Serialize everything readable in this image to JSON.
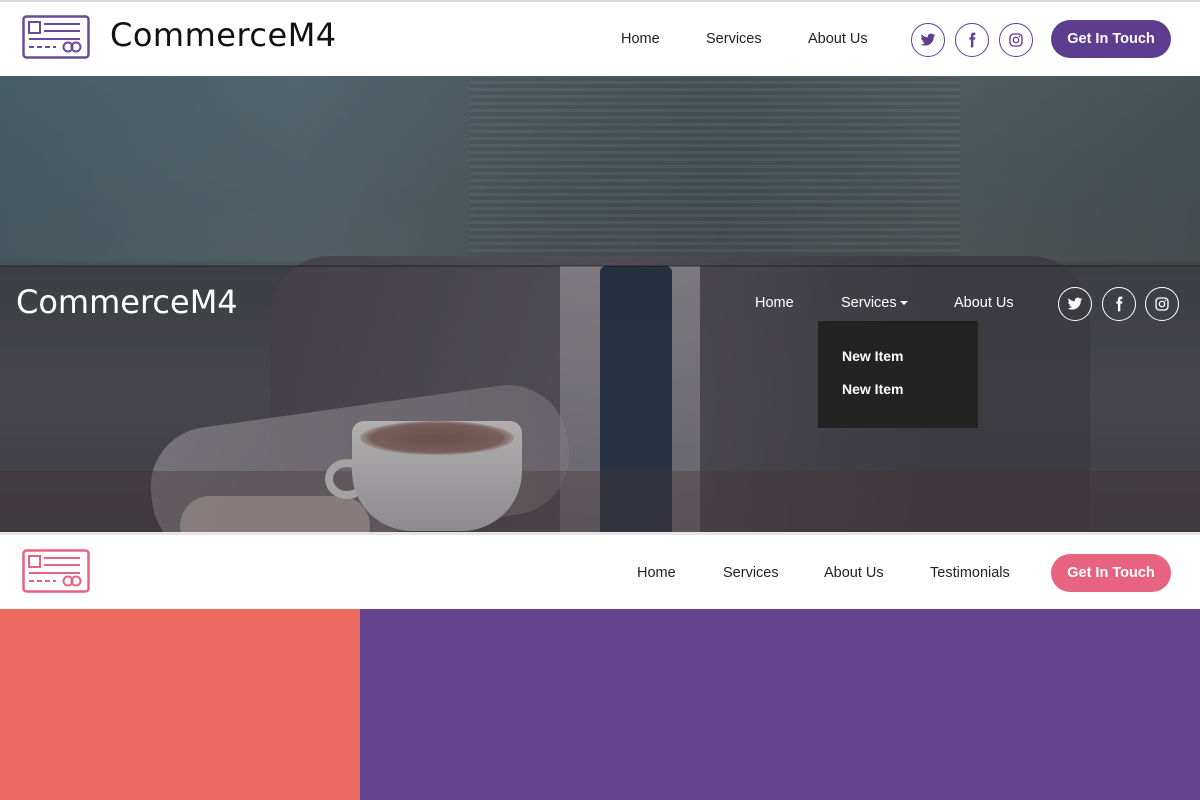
{
  "header_top": {
    "brand": "CommerceM4",
    "nav": [
      "Home",
      "Services",
      "About Us"
    ],
    "social_icons": [
      "twitter-icon",
      "facebook-icon",
      "instagram-icon"
    ],
    "cta_label": "Get In Touch",
    "accent_color": "#5c3d8f"
  },
  "hero": {
    "brand": "CommerceM4",
    "nav": [
      "Home",
      "Services",
      "About Us"
    ],
    "social_icons": [
      "twitter-icon",
      "facebook-icon",
      "instagram-icon"
    ],
    "dropdown": {
      "parent": "Services",
      "items": [
        "New Item",
        "New Item"
      ]
    }
  },
  "header_bottom": {
    "nav": [
      "Home",
      "Services",
      "About Us",
      "Testimonials"
    ],
    "cta_label": "Get In Touch",
    "accent_color": "#e8637f"
  },
  "blocks": {
    "left_color": "#eb6a5f",
    "right_color": "#66438f"
  }
}
